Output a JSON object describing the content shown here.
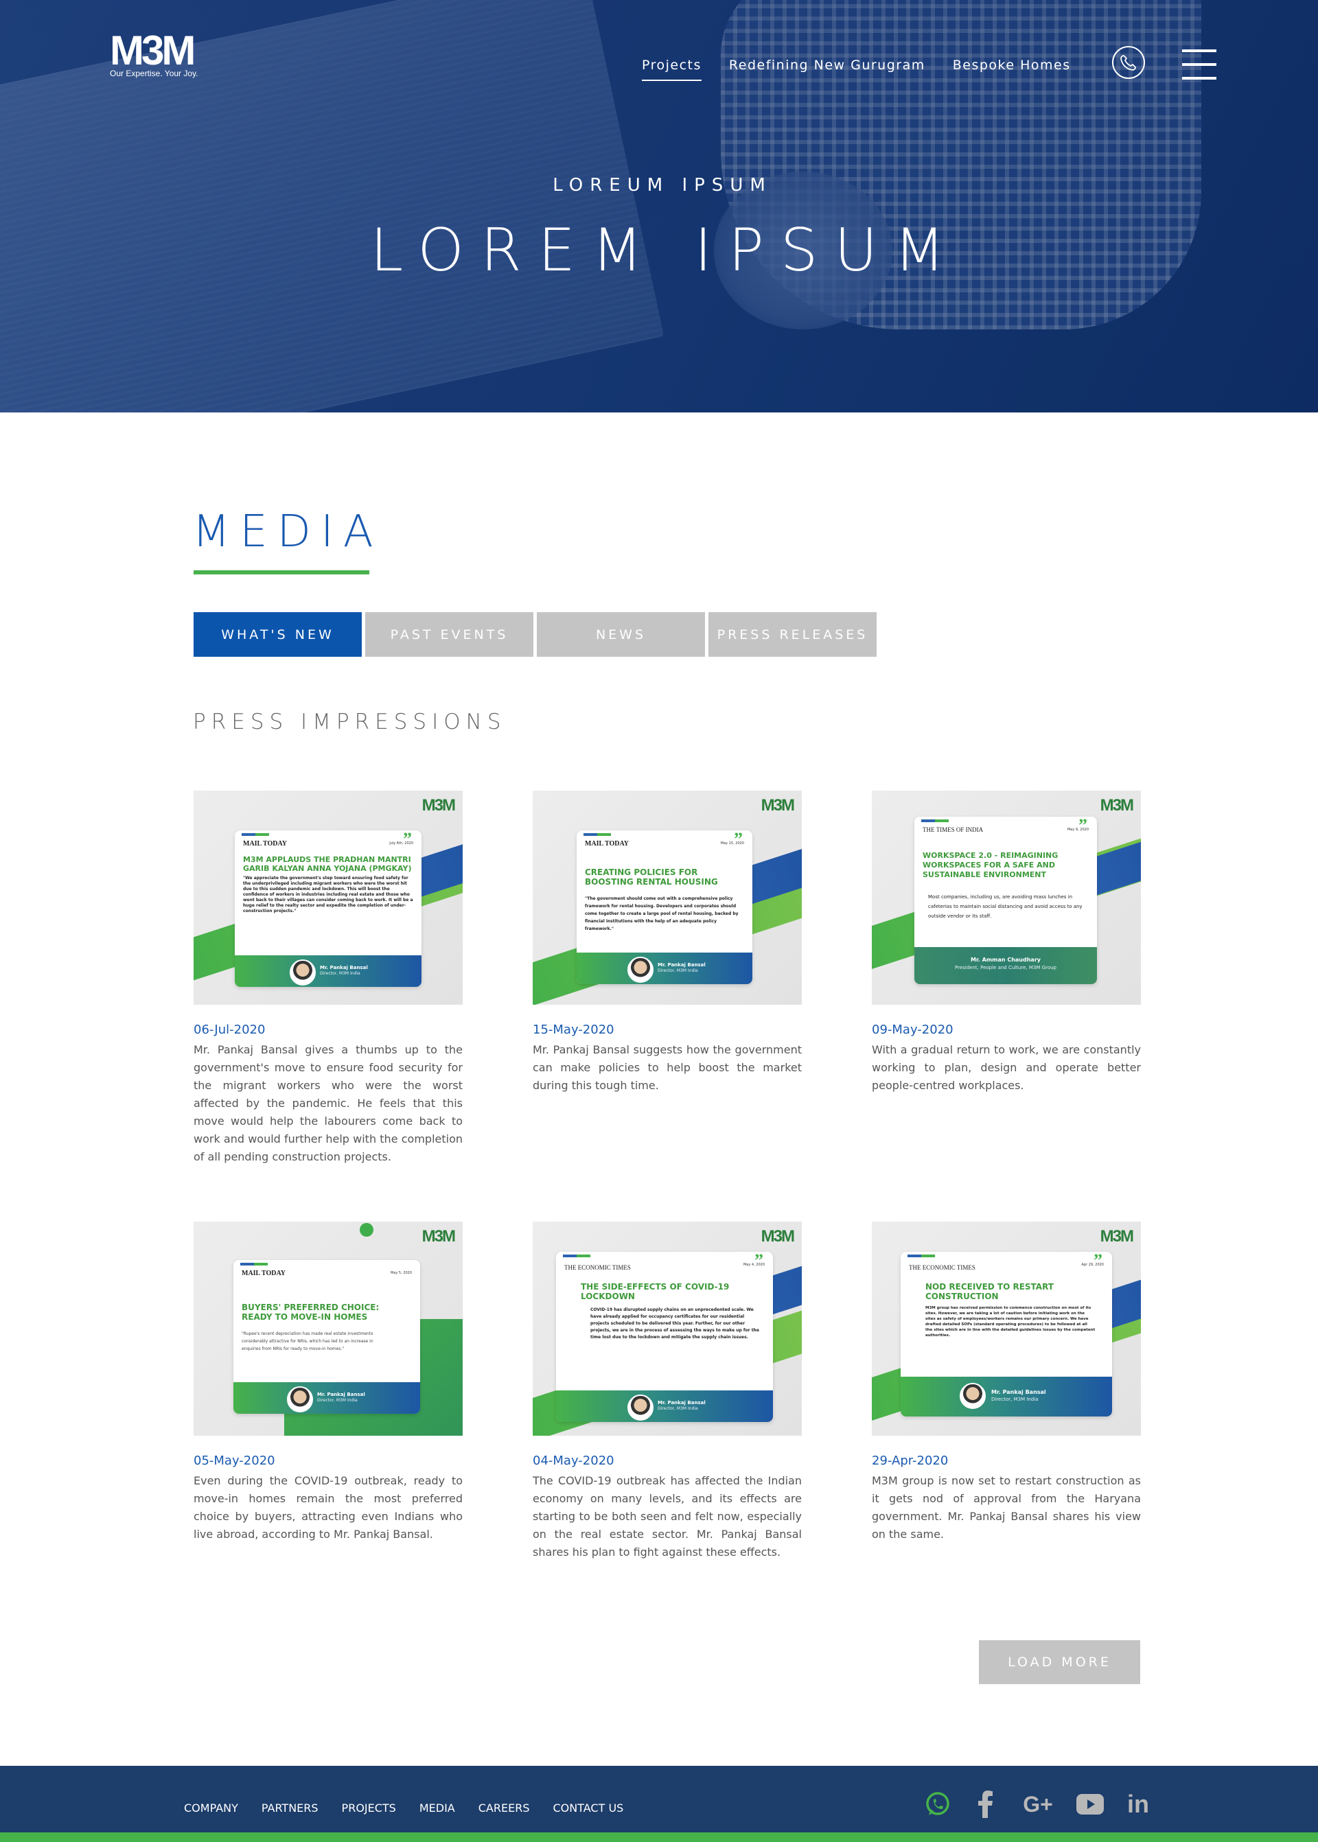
{
  "brand": {
    "logo_text": "M3M",
    "tagline": "Our Expertise. Your Joy."
  },
  "nav": {
    "items": [
      {
        "label": "Projects",
        "active": true
      },
      {
        "label": "Redefining New Gurugram",
        "active": false
      },
      {
        "label": "Bespoke Homes",
        "active": false
      }
    ],
    "phone_icon": "phone-icon",
    "menu_icon": "hamburger-menu-icon"
  },
  "hero": {
    "subtitle": "LOREUM IPSUM",
    "title": "LOREM IPSUM"
  },
  "media": {
    "title": "MEDIA",
    "accent_color": "#46b24a",
    "heading_color": "#1a5ab0",
    "tabs": [
      {
        "label": "WHAT'S NEW",
        "active": true
      },
      {
        "label": "PAST EVENTS",
        "active": false
      },
      {
        "label": "NEWS",
        "active": false
      },
      {
        "label": "PRESS RELEASES",
        "active": false
      }
    ],
    "section_title": "PRESS IMPRESSIONS",
    "cards": [
      {
        "date": "06-Jul-2020",
        "description": "Mr. Pankaj Bansal gives a thumbs up to the government's move to ensure food security for the migrant workers who were the worst affected by the pandemic. He feels that this move would help the labourers come back to work and would further help with the completion of all pending construction projects.",
        "image": {
          "publication": "MAIL TODAY",
          "pub_date": "July 6th, 2020",
          "headline": "M3M APPLAUDS THE PRADHAN MANTRI GARIB KALYAN ANNA YOJANA (PMGKAY)",
          "quote": "\"We appreciate the government's step toward ensuring food safety for the underprivileged including migrant workers who were the worst hit due to this sudden pandemic and lockdown. This will boost the confidence of workers in industries including real estate and those who went back to their villages can consider coming back to work. It will be a huge relief to the realty sector and expedite the completion of under-construction projects.\"",
          "person": "Mr. Pankaj Bansal",
          "person_title": "Director, M3M India"
        }
      },
      {
        "date": "15-May-2020",
        "description": "Mr. Pankaj Bansal suggests how the government can make policies to help boost the market during this tough time.",
        "image": {
          "publication": "MAIL TODAY",
          "pub_date": "May 15, 2020",
          "headline": "CREATING POLICIES FOR BOOSTING RENTAL HOUSING",
          "quote": "\"The government should come out with a comprehensive policy framework for rental housing. Developers and corporates should come together to create a large pool of rental housing, backed by financial institutions with the help of an adequate policy framework.\"",
          "person": "Mr. Pankaj Bansal",
          "person_title": "Director, M3M India"
        }
      },
      {
        "date": "09-May-2020",
        "description": "With a gradual return to work, we are constantly working to plan, design and operate better people-centred workplaces.",
        "image": {
          "publication": "THE TIMES OF INDIA",
          "pub_date": "May 9, 2020",
          "headline": "WORKSPACE 2.0 - REIMAGINING WORKSPACES FOR A SAFE AND SUSTAINABLE ENVIRONMENT",
          "quote": "Most companies, including us, are avoiding mass lunches in cafeterias to maintain social distancing and avoid access to any outside vendor or its staff.",
          "person": "Mr. Amman Chaudhary",
          "person_title": "President, People and Culture, M3M Group"
        }
      },
      {
        "date": "05-May-2020",
        "description": "Even during the COVID-19 outbreak, ready to move-in homes remain the most preferred choice by buyers, attracting even Indians who live abroad, according to Mr. Pankaj Bansal.",
        "image": {
          "publication": "MAIL TODAY",
          "pub_date": "May 5, 2020",
          "headline": "BUYERS' PREFERRED CHOICE: READY TO MOVE-IN HOMES",
          "quote": "\"Rupee's recent depreciation has made real estate investments considerably attractive for NRIs, which has led to an increase in enquiries from NRIs for ready to move-in homes.\"",
          "person": "Mr. Pankaj Bansal",
          "person_title": "Director, M3M India"
        }
      },
      {
        "date": "04-May-2020",
        "description": "The COVID-19 outbreak has affected the Indian economy on many levels, and its effects are starting to be both seen and felt now, especially on the real estate sector. Mr. Pankaj Bansal shares his plan to fight against these effects.",
        "image": {
          "publication": "THE ECONOMIC TIMES",
          "pub_date": "May 4, 2020",
          "headline": "THE SIDE-EFFECTS OF COVID-19 LOCKDOWN",
          "quote": "COVID-19 has disrupted supply chains on an unprecedented scale. We have already applied for occupancy certificates for our residential projects scheduled to be delivered this year. Further, for our other projects, we are in the process of assessing the ways to make up for the time lost due to the lockdown and mitigate the supply chain issues.",
          "person": "Mr. Pankaj Bansal",
          "person_title": "Director, M3M India"
        }
      },
      {
        "date": "29-Apr-2020",
        "description": "M3M group is now set to restart construction as it gets nod of approval from the Haryana government. Mr. Pankaj Bansal shares his view on the same.",
        "image": {
          "publication": "THE ECONOMIC TIMES",
          "pub_date": "Apr 29, 2020",
          "headline": "NOD RECEIVED TO RESTART CONSTRUCTION",
          "quote": "M3M group has received permission to commence construction on most of its sites. However, we are taking a lot of caution before initiating work on the sites as safety of employees/workers remains our primary concern. We have drafted detailed SOPs (standard operating procedures) to be followed at all the sites which are in line with the detailed guidelines issues by the competent authorities.",
          "person": "Mr. Pankaj Bansal",
          "person_title": "Director, M3M India"
        }
      }
    ],
    "load_more": "LOAD MORE"
  },
  "footer": {
    "links": [
      "COMPANY",
      "PARTNERS",
      "PROJECTS",
      "MEDIA",
      "CAREERS",
      "CONTACT US"
    ],
    "social": [
      {
        "icon": "whatsapp-icon",
        "color": "#46b24a"
      },
      {
        "icon": "facebook-icon",
        "color": "#b8b8b8"
      },
      {
        "icon": "google-plus-icon",
        "color": "#b8b8b8"
      },
      {
        "icon": "youtube-icon",
        "color": "#b8b8b8"
      },
      {
        "icon": "linkedin-icon",
        "color": "#b8b8b8"
      }
    ],
    "background": "#1d3d6a",
    "accent_bar": "#46b24a"
  }
}
